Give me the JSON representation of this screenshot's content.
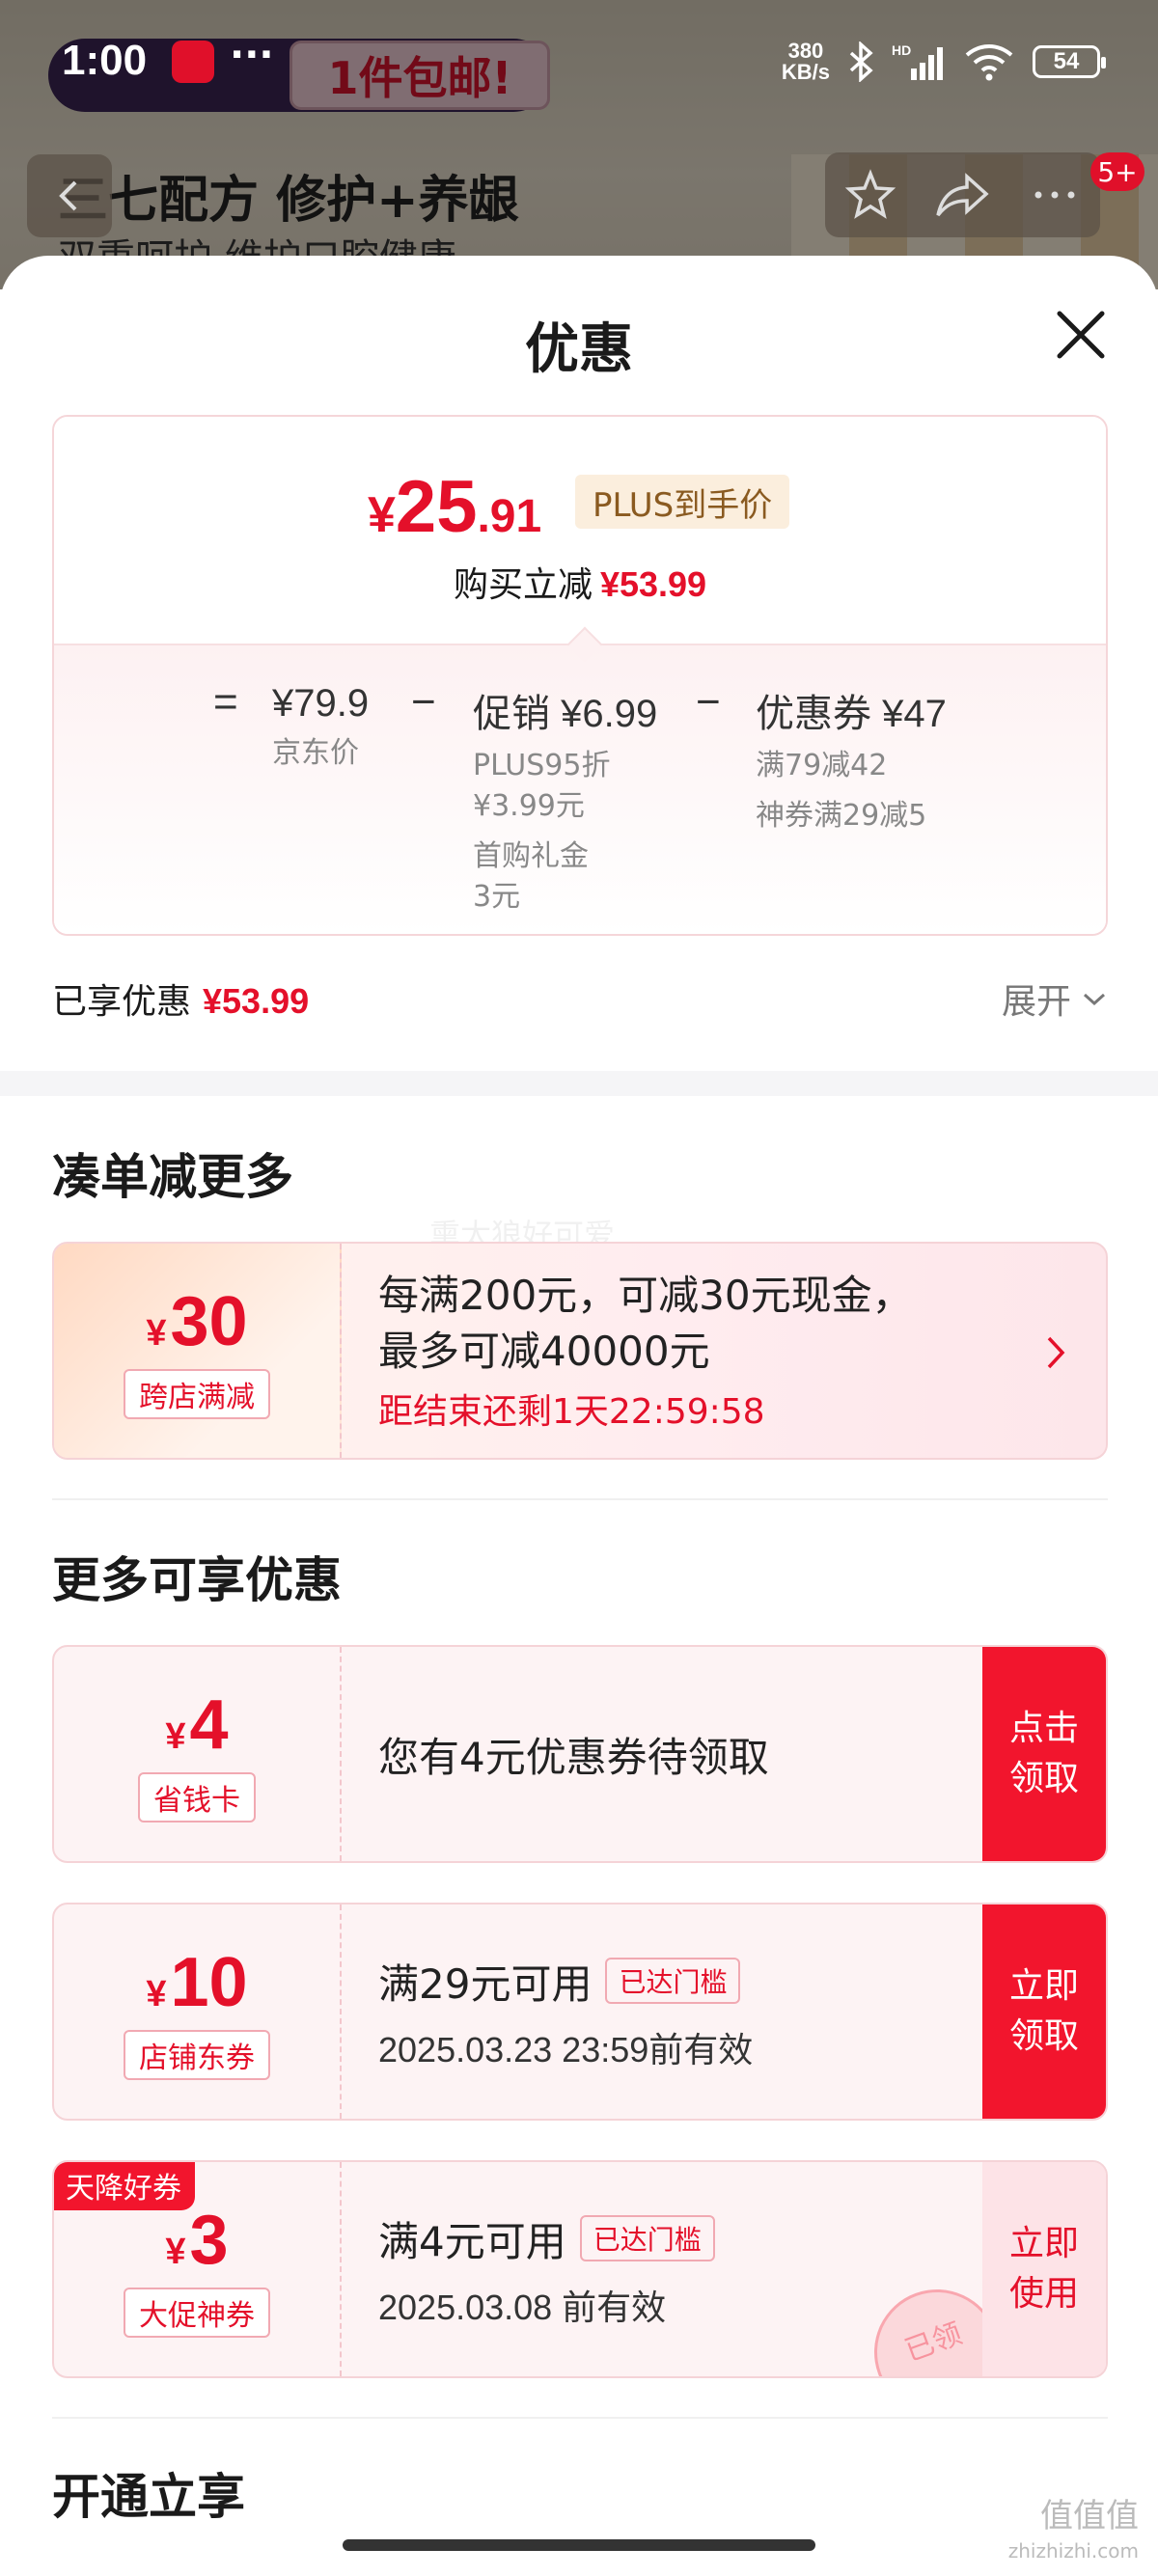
{
  "status_bar": {
    "time": "1:00",
    "dots": "···",
    "net_speed_value": "380",
    "net_speed_unit": "KB/s",
    "battery": "54"
  },
  "background_page": {
    "promo": "1件包邮!",
    "title": "三七配方 修护+养龈",
    "subtitle": "双重呵护 维护口腔健康",
    "badge": "5+"
  },
  "sheet": {
    "title": "优惠",
    "price_box": {
      "currency": "¥",
      "price_int": "25",
      "price_dec": ".91",
      "plus_tag": "PLUS到手价",
      "reduce_label": "购买立减",
      "reduce_amount": "¥53.99",
      "equals": "=",
      "minus": "−",
      "jd_price": "¥79.9",
      "jd_price_label": "京东价",
      "promo_main": "促销 ¥6.99",
      "promo_sub1": "PLUS95折",
      "promo_sub2": "¥3.99元",
      "promo_sub3": "首购礼金",
      "promo_sub4": "3元",
      "coupon_main": "优惠券 ¥47",
      "coupon_sub1": "满79减42",
      "coupon_sub2": "神券满29减5"
    },
    "enjoyed": {
      "label": "已享优惠",
      "amount": "¥53.99",
      "expand": "展开"
    },
    "section_bundle": "凑单减更多",
    "watermark": "熏太狼好可爱",
    "bundle_card": {
      "currency": "¥",
      "amount": "30",
      "tag": "跨店满减",
      "line1": "每满200元，可减30元现金，",
      "line2": "最多可减40000元",
      "countdown": "距结束还剩1天22:59:58"
    },
    "section_more": "更多可享优惠",
    "coupons": [
      {
        "currency": "¥",
        "amount": "4",
        "tag": "省钱卡",
        "line1": "您有4元优惠券待领取",
        "cta": "点击领取"
      },
      {
        "currency": "¥",
        "amount": "10",
        "tag": "店铺东券",
        "line1": "满29元可用",
        "badge": "已达门槛",
        "line2": "2025.03.23 23:59前有效",
        "cta": "立即领取"
      },
      {
        "corner_tag": "天降好券",
        "currency": "¥",
        "amount": "3",
        "tag": "大促神券",
        "line1": "满4元可用",
        "badge": "已达门槛",
        "line2": "2025.03.08 前有效",
        "cta": "立即使用",
        "stamp": "已领"
      }
    ],
    "section_open": "开通立享"
  },
  "site_mark": {
    "big": "值值值",
    "small": "zhizhizhi.com"
  },
  "colors": {
    "accent": "#e4102a",
    "cta": "#f2152d",
    "plus_tag_bg": "#fbeedd"
  }
}
